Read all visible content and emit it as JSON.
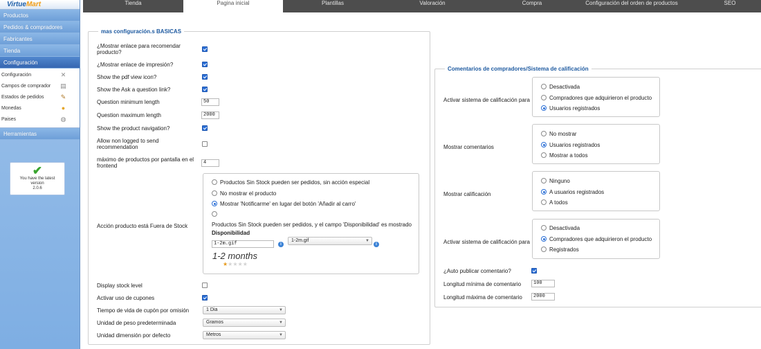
{
  "brand": {
    "logo_prefix": "Virtue",
    "logo_suffix": "Mart"
  },
  "sidebar": {
    "menu_top": [
      "Productos",
      "Pedidos & compradores",
      "Fabricantes",
      "Tienda"
    ],
    "active": "Configuración",
    "submenu": [
      {
        "label": "Configuración",
        "icon": "settings-icon"
      },
      {
        "label": "Campos de comprador",
        "icon": "form-icon"
      },
      {
        "label": "Estados de pedidos",
        "icon": "status-icon"
      },
      {
        "label": "Monedas",
        "icon": "coins-icon"
      },
      {
        "label": "Paises",
        "icon": "globe-icon"
      }
    ],
    "tools": "Herramientas",
    "version_line1": "You have the latest",
    "version_line2": "version",
    "version_num": "2.0.6"
  },
  "tabs": [
    "Tienda",
    "Pagina inicial",
    "Plantillas",
    "Valoración",
    "Compra",
    "Configuración del orden de productos",
    "SEO"
  ],
  "active_tab": "Pagina inicial",
  "basic": {
    "legend": "mas configuración.s BASICAS",
    "recommend_label": "¿Mostrar enlace para recomendar producto?",
    "print_label": "¿Mostrar enlace de impresión?",
    "pdf_label": "Show the pdf view icon?",
    "ask_label": "Show the Ask a question link?",
    "qmin_label": "Question minimum length",
    "qmin_value": "50",
    "qmax_label": "Question maximum length",
    "qmax_value": "2000",
    "nav_label": "Show the product navigation?",
    "nonlogged_label": "Allow non logged to send recommendation",
    "perpage_label": "máximo de productos por pantalla en el frontend",
    "perpage_value": "4",
    "stock_action_label": "Acción producto está Fuera de Stock",
    "stock_options": [
      "Productos Sin Stock pueden ser pedidos, sin acción especial",
      "No mostrar el producto",
      "Mostrar 'Notificarme' en lugar del botón 'Añadir al carro'",
      "Productos Sin Stock pueden ser pedidos, y el campo 'Disponibilidad' es mostrado"
    ],
    "stock_selected": 2,
    "availability_title": "Disponibilidad",
    "availability_value": "1-2m.gif",
    "availability_select": "1-2m.gif",
    "months_text": "1-2 months",
    "stars": 1,
    "display_stock_label": "Display stock level",
    "coupons_label": "Activar uso de cupones",
    "coupon_life_label": "Tiempo de vida de cupón por omisión",
    "coupon_life_value": "1 Dia",
    "weight_label": "Unidad de peso predeterminada",
    "weight_value": "Gramos",
    "dimension_label": "Unidad dimensión por defecto",
    "dimension_value": "Metros"
  },
  "reviews": {
    "legend": "Comentarios de compradores/Sistema de calificación",
    "rating_label": "Activar sistema de calificación para",
    "rating_options": [
      "Desactivada",
      "Compradores que adquirieron el producto",
      "Usuarios registrados"
    ],
    "rating_selected": 2,
    "show_comments_label": "Mostrar comentarios",
    "show_comments_options": [
      "No mostrar",
      "Usuarios registrados",
      "Mostrar a todos"
    ],
    "show_comments_selected": 1,
    "show_rating_label": "Mostrar calificación",
    "show_rating_options": [
      "Ninguno",
      "A usuarios registrados",
      "A todos"
    ],
    "show_rating_selected": 1,
    "review_system_label": "Activar sistema de calificación para",
    "review_system_options": [
      "Desactivada",
      "Compradores que adquirieron el producto",
      "Registrados"
    ],
    "review_system_selected": 1,
    "autopublish_label": "¿Auto publicar comentario?",
    "min_len_label": "Longitud mínima de comentario",
    "min_len_value": "100",
    "max_len_label": "Longitud máxima de comentario",
    "max_len_value": "2000"
  }
}
